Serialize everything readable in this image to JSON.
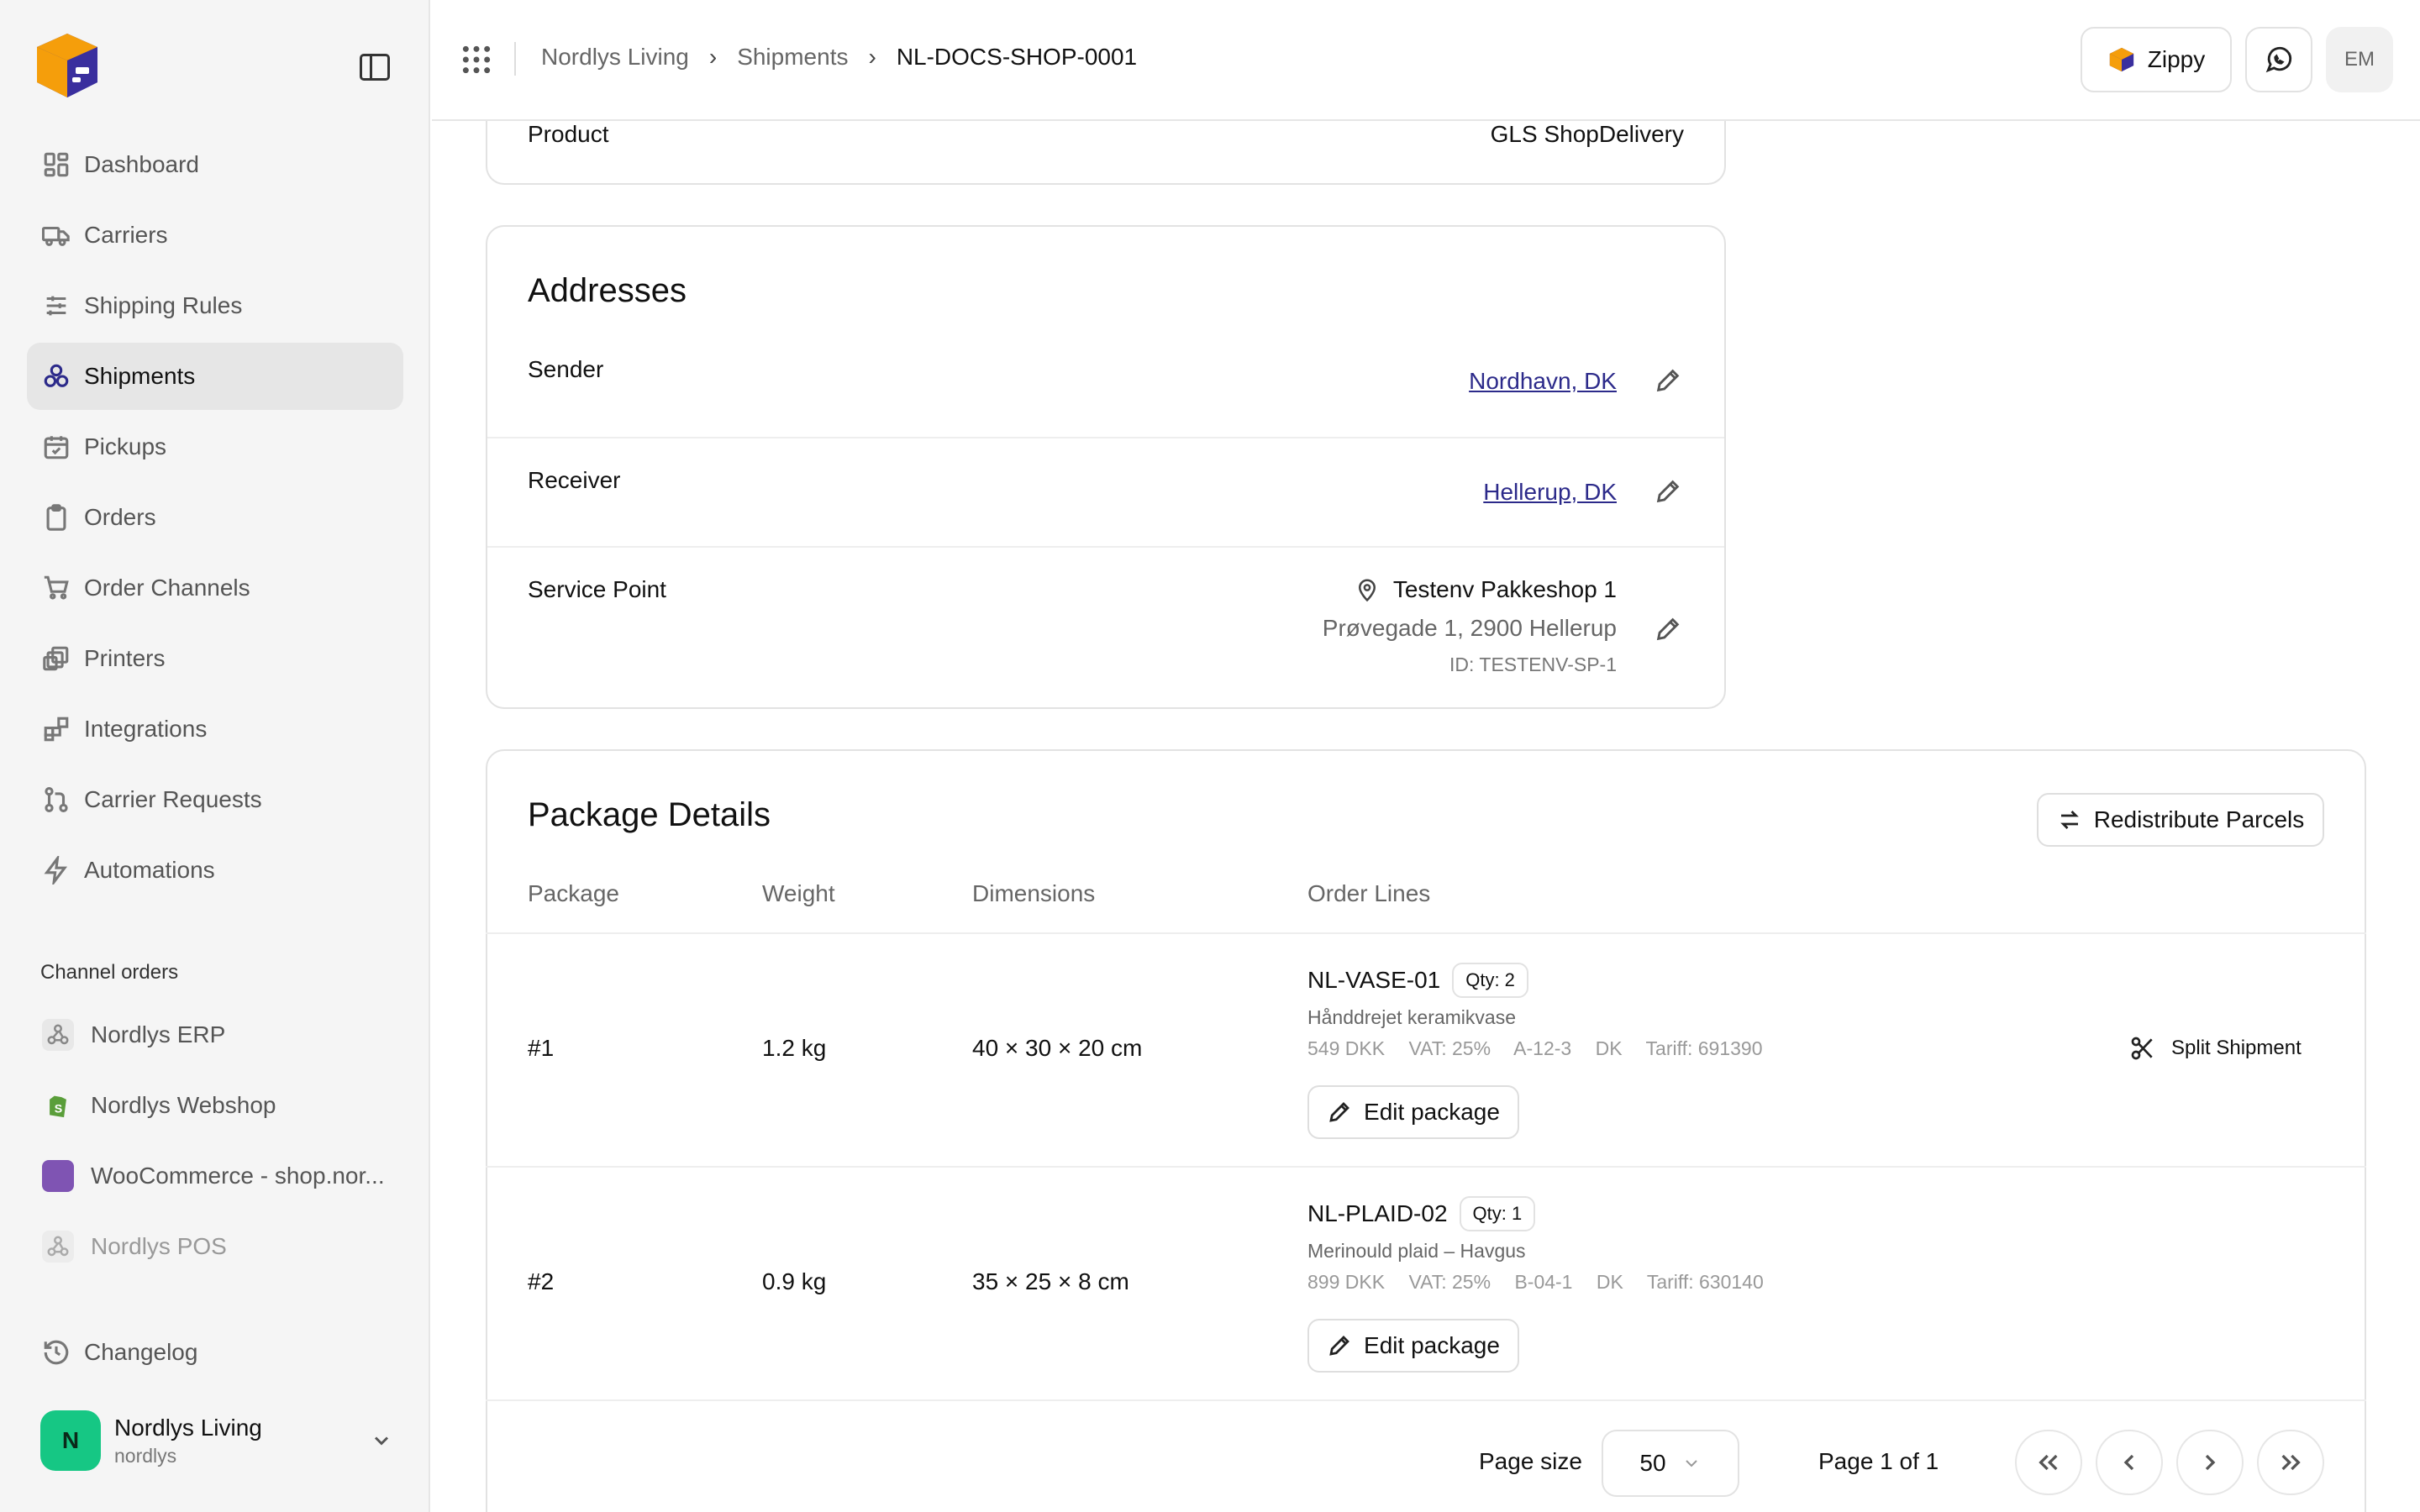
{
  "sidebar": {
    "nav": [
      {
        "label": "Dashboard",
        "icon": "dashboard-icon"
      },
      {
        "label": "Carriers",
        "icon": "truck-icon"
      },
      {
        "label": "Shipping Rules",
        "icon": "sliders-icon"
      },
      {
        "label": "Shipments",
        "icon": "boxes-icon",
        "active": true
      },
      {
        "label": "Pickups",
        "icon": "calendar-icon"
      },
      {
        "label": "Orders",
        "icon": "clipboard-icon"
      },
      {
        "label": "Order Channels",
        "icon": "cart-icon"
      },
      {
        "label": "Printers",
        "icon": "printer-icon"
      },
      {
        "label": "Integrations",
        "icon": "blocks-icon"
      },
      {
        "label": "Carrier Requests",
        "icon": "git-pull-icon"
      },
      {
        "label": "Automations",
        "icon": "bolt-icon"
      }
    ],
    "section_label": "Channel orders",
    "channels": [
      {
        "label": "Nordlys ERP",
        "icon": "webhook-icon"
      },
      {
        "label": "Nordlys Webshop",
        "icon": "shopify-icon"
      },
      {
        "label": "WooCommerce - shop.nor...",
        "icon": "woocommerce-icon"
      },
      {
        "label": "Nordlys POS",
        "icon": "webhook-icon"
      }
    ],
    "changelog": "Changelog",
    "account": {
      "initial": "N",
      "name": "Nordlys Living",
      "handle": "nordlys"
    }
  },
  "header": {
    "breadcrumbs": [
      "Nordlys Living",
      "Shipments",
      "NL-DOCS-SHOP-0001"
    ],
    "zippy_label": "Zippy",
    "user_initials": "EM"
  },
  "product": {
    "label": "Product",
    "value": "GLS ShopDelivery"
  },
  "addresses": {
    "title": "Addresses",
    "sender": {
      "label": "Sender",
      "value": "Nordhavn, DK"
    },
    "receiver": {
      "label": "Receiver",
      "value": "Hellerup, DK"
    },
    "service_point": {
      "label": "Service Point",
      "name": "Testenv Pakkeshop 1",
      "address": "Prøvegade 1, 2900 Hellerup",
      "id": "ID: TESTENV-SP-1"
    }
  },
  "packages": {
    "title": "Package Details",
    "redistribute_label": "Redistribute Parcels",
    "columns": [
      "Package",
      "Weight",
      "Dimensions",
      "Order Lines"
    ],
    "rows": [
      {
        "package": "#1",
        "weight": "1.2 kg",
        "dimensions": "40 × 30 × 20 cm",
        "sku": "NL-VASE-01",
        "qty": "Qty: 2",
        "description": "Hånddrejet keramikvase",
        "meta": [
          "549 DKK",
          "VAT: 25%",
          "A-12-3",
          "DK",
          "Tariff: 691390"
        ],
        "edit_label": "Edit package",
        "split_label": "Split Shipment"
      },
      {
        "package": "#2",
        "weight": "0.9 kg",
        "dimensions": "35 × 25 × 8 cm",
        "sku": "NL-PLAID-02",
        "qty": "Qty: 1",
        "description": "Merinould plaid – Havgus",
        "meta": [
          "899 DKK",
          "VAT: 25%",
          "B-04-1",
          "DK",
          "Tariff: 630140"
        ],
        "edit_label": "Edit package"
      }
    ],
    "pager": {
      "page_size_label": "Page size",
      "page_size": "50",
      "page_info": "Page 1 of 1"
    }
  }
}
